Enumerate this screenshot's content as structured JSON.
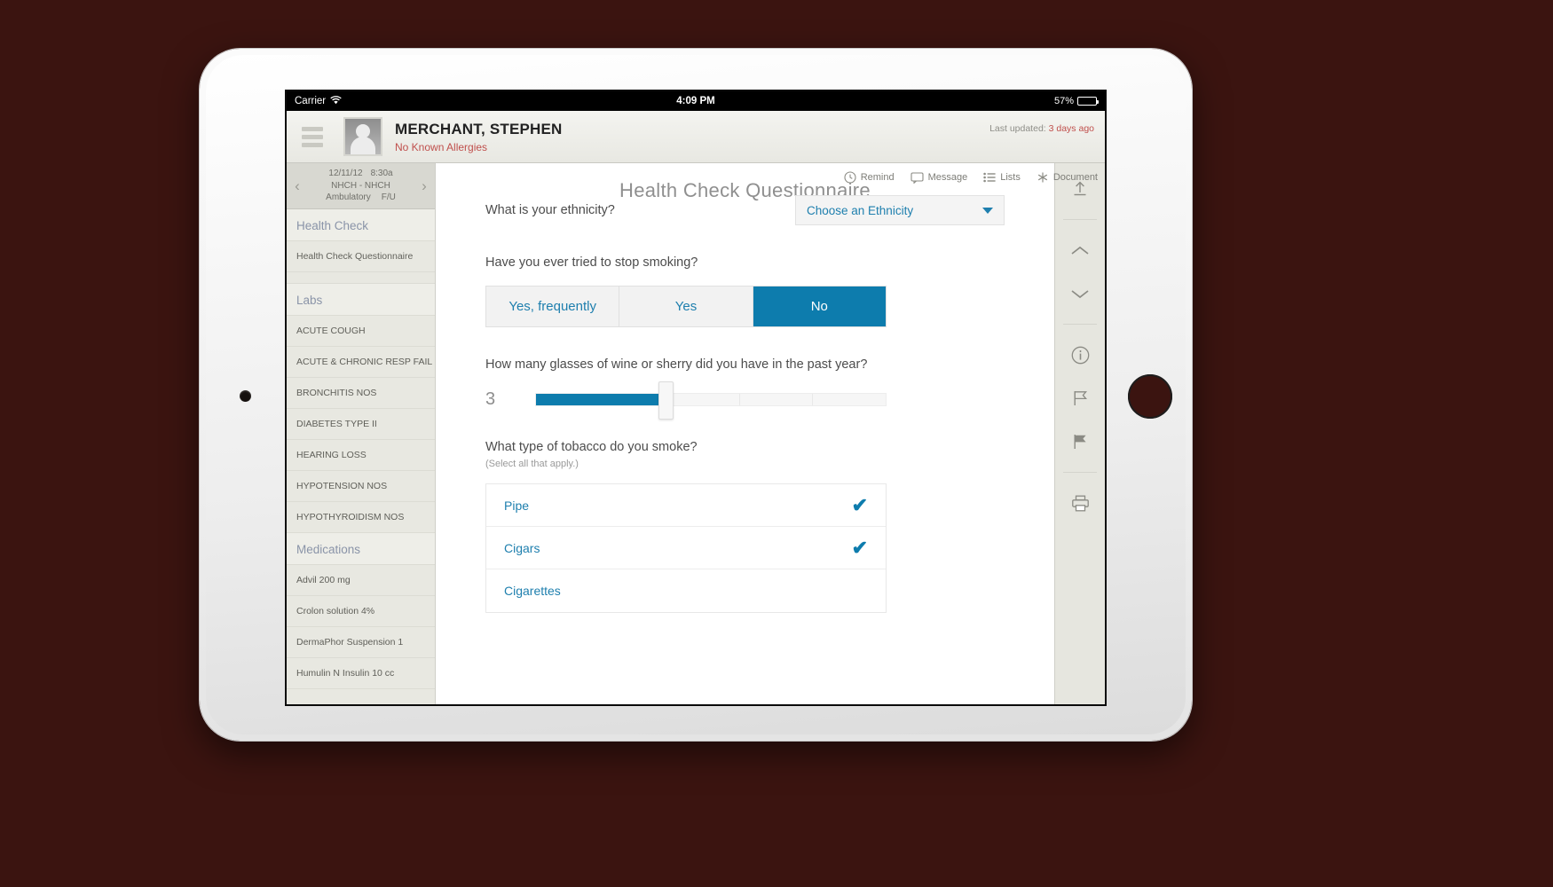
{
  "status_bar": {
    "carrier": "Carrier",
    "wifi_icon": "wifi-icon",
    "time": "4:09 PM",
    "battery_percent": "57%",
    "battery_level": 57
  },
  "header": {
    "menu_icon": "hamburger-icon",
    "avatar_icon": "avatar-placeholder-icon",
    "patient_name": "MERCHANT, STEPHEN",
    "allergies": "No Known Allergies",
    "last_updated_label": "Last updated:",
    "last_updated_value": "3 days ago"
  },
  "action_bar": {
    "items": [
      {
        "label": "Remind",
        "icon": "clock-icon"
      },
      {
        "label": "Message",
        "icon": "speech-bubble-icon"
      },
      {
        "label": "Lists",
        "icon": "list-icon"
      },
      {
        "label": "Document",
        "icon": "asterisk-icon"
      }
    ]
  },
  "sidebar": {
    "encounter": {
      "prev_icon": "chevron-left-icon",
      "next_icon": "chevron-right-icon",
      "date": "12/11/12",
      "time": "8:30a",
      "facility": "NHCH - NHCH",
      "type": "Ambulatory",
      "visit": "F/U"
    },
    "sections": [
      {
        "title": "Health Check",
        "items": [
          "Health Check Questionnaire"
        ]
      },
      {
        "title": "Labs",
        "items": [
          "ACUTE COUGH",
          "ACUTE & CHRONIC RESP FAIL",
          "BRONCHITIS NOS",
          "DIABETES TYPE II",
          "HEARING LOSS",
          "HYPOTENSION NOS",
          "HYPOTHYROIDISM NOS"
        ]
      },
      {
        "title": "Medications",
        "items": [
          "Advil 200 mg",
          "Crolon solution 4%",
          "DermaPhor Suspension 1",
          "Humulin N Insulin  10 cc"
        ]
      }
    ]
  },
  "main": {
    "title": "Health Check Questionnaire",
    "ethnicity": {
      "question": "What is your ethnicity?",
      "selected": "Choose an Ethnicity",
      "chevron_icon": "chevron-down-icon"
    },
    "stop_smoking": {
      "question": "Have you ever tried to stop smoking?",
      "options": [
        "Yes, frequently",
        "Yes",
        "No"
      ],
      "selected": "No"
    },
    "wine": {
      "question": "How many glasses of wine or sherry did you have in the past year?",
      "value": "3",
      "fill_percent": 35
    },
    "tobacco": {
      "question": "What type of tobacco do you smoke?",
      "hint": "(Select all that apply.)",
      "options": [
        {
          "label": "Pipe",
          "checked": true,
          "check_icon": "checkmark-icon"
        },
        {
          "label": "Cigars",
          "checked": true,
          "check_icon": "checkmark-icon"
        },
        {
          "label": "Cigarettes",
          "checked": false,
          "check_icon": "checkmark-icon"
        }
      ]
    }
  },
  "right_rail": {
    "buttons": [
      "upload-icon",
      "chevron-up-icon",
      "chevron-down-icon",
      "info-icon",
      "flag-outline-icon",
      "flag-filled-icon",
      "print-icon"
    ]
  },
  "colors": {
    "accent_blue": "#0d7cad",
    "link_blue": "#1e7fae",
    "alert_red": "#c0504d",
    "section_header": "#8a94a8"
  }
}
